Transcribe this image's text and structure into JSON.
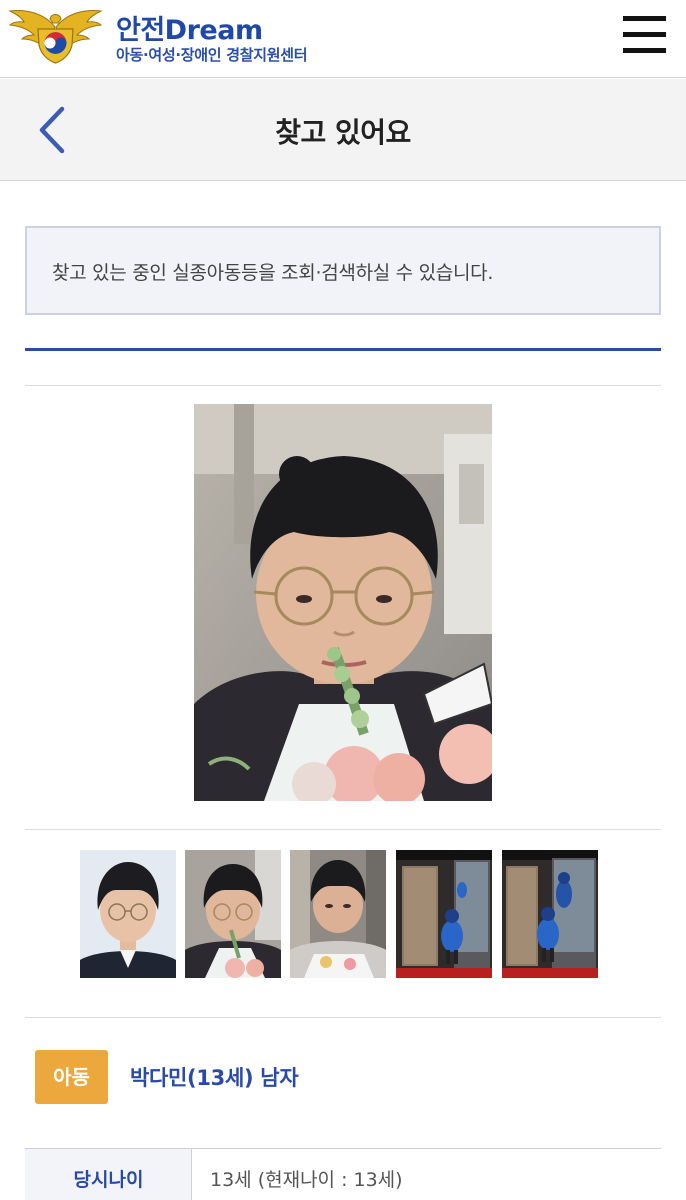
{
  "header": {
    "brand_title": "안전Dream",
    "brand_subtitle": "아동·여성·장애인 경찰지원센터",
    "logo_icon": "police-emblem-icon",
    "menu_icon": "hamburger-menu-icon"
  },
  "titlebar": {
    "back_icon": "chevron-left-icon",
    "title": "찾고 있어요"
  },
  "notice": {
    "text": "찾고 있는 중인 실종아동등을 조회·검색하실 수 있습니다."
  },
  "photos": {
    "main": "portrait-photo",
    "thumbnails": [
      "id-photo",
      "portrait-with-flowers",
      "portrait-with-bouquet",
      "cctv-still-1",
      "cctv-still-2"
    ]
  },
  "person": {
    "category": "아동",
    "name": "박다민(13세) 남자"
  },
  "details": [
    {
      "label": "당시나이",
      "value": "13세 (현재나이 : 13세)"
    }
  ],
  "colors": {
    "brand_blue": "#1f48a8",
    "accent_orange": "#eca73d",
    "rule_blue": "#2c4aa5"
  }
}
